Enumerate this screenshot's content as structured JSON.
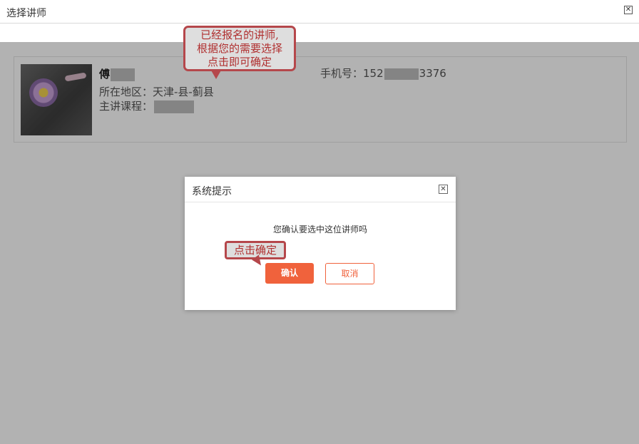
{
  "window": {
    "title": "选择讲师",
    "close_symbol": "✕"
  },
  "teacher": {
    "name": "傅",
    "region_label": "所在地区：",
    "region_value": "天津-县-蓟县",
    "course_label": "主讲课程：",
    "phone_label": "手机号：",
    "phone_prefix": "152",
    "phone_suffix": "3376"
  },
  "annotations": {
    "callout1": [
      "已经报名的讲师,",
      "根据您的需要选择",
      "点击即可确定"
    ],
    "callout2": "点击确定"
  },
  "dialog": {
    "title": "系统提示",
    "close_symbol": "✕",
    "message": "您确认要选中这位讲师吗",
    "confirm_label": "确认",
    "cancel_label": "取消"
  },
  "colors": {
    "accent": "#f0623c",
    "annotation_border": "#b5474b"
  }
}
